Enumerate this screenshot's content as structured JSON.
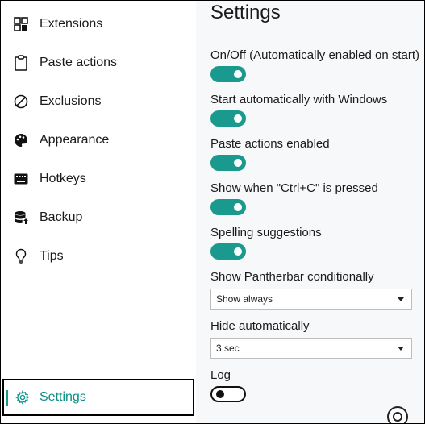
{
  "sidebar": {
    "items": [
      {
        "label": "Extensions",
        "icon": "extensions-icon"
      },
      {
        "label": "Paste actions",
        "icon": "clipboard-icon"
      },
      {
        "label": "Exclusions",
        "icon": "block-icon"
      },
      {
        "label": "Appearance",
        "icon": "palette-icon"
      },
      {
        "label": "Hotkeys",
        "icon": "keyboard-icon"
      },
      {
        "label": "Backup",
        "icon": "database-icon"
      },
      {
        "label": "Tips",
        "icon": "lightbulb-icon"
      }
    ],
    "settings": {
      "label": "Settings",
      "icon": "gear-icon"
    }
  },
  "main": {
    "title": "Settings",
    "options": [
      {
        "label": "On/Off (Automatically enabled on start)",
        "state": "on"
      },
      {
        "label": "Start automatically with Windows",
        "state": "on"
      },
      {
        "label": "Paste actions enabled",
        "state": "on"
      },
      {
        "label": "Show when \"Ctrl+C\" is pressed",
        "state": "on"
      },
      {
        "label": "Spelling suggestions",
        "state": "on"
      }
    ],
    "show_conditionally": {
      "label": "Show Pantherbar conditionally",
      "value": "Show always"
    },
    "hide_automatically": {
      "label": "Hide automatically",
      "value": "3 sec"
    },
    "log": {
      "label": "Log",
      "state": "off"
    }
  },
  "colors": {
    "accent": "#1a9a8e",
    "accent_text": "#0b8f84",
    "panel_bg": "#f7f8f9"
  }
}
